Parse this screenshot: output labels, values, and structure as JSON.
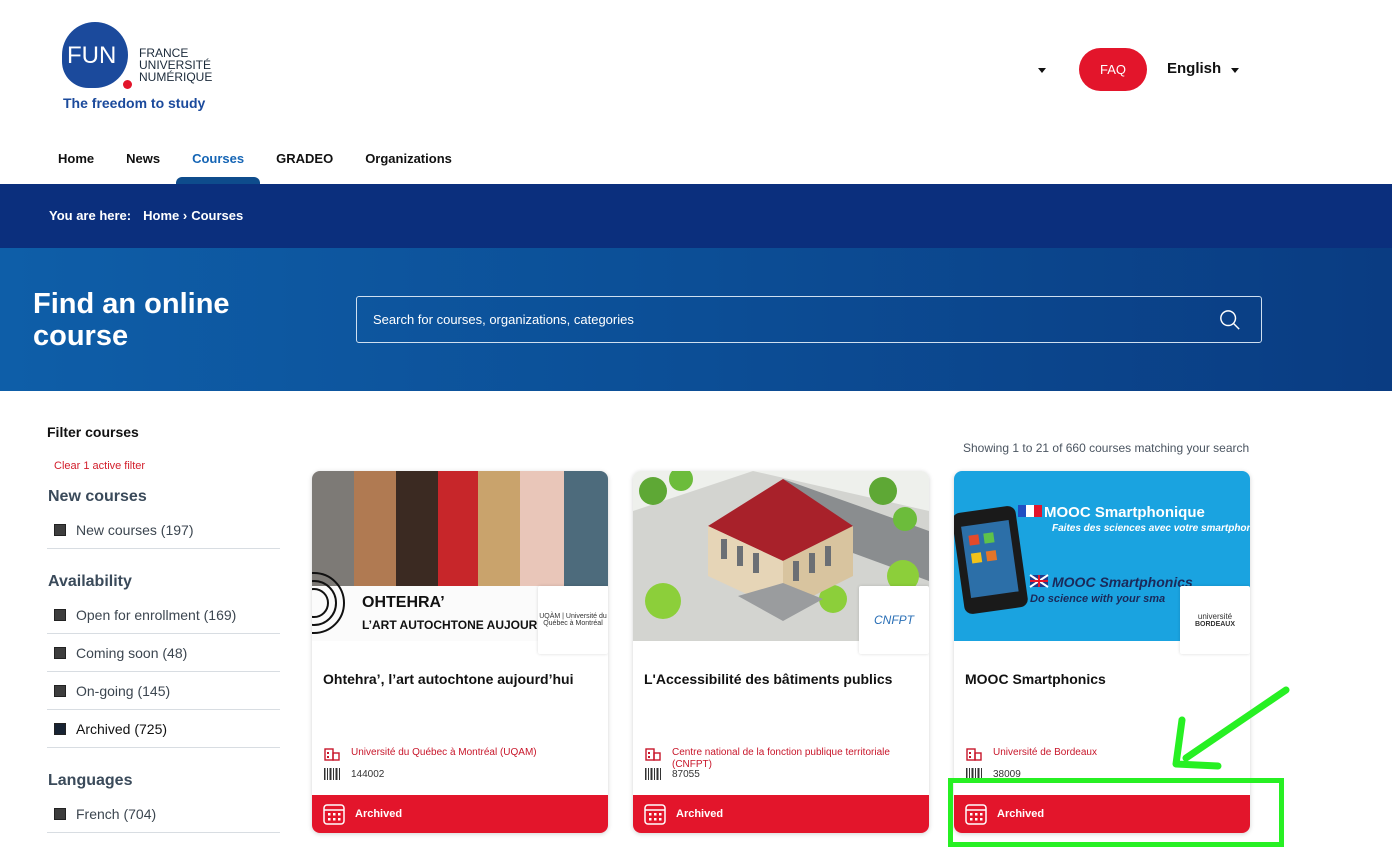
{
  "header": {
    "logo": {
      "mark": "FUN",
      "line1": "FRANCE",
      "line2": "UNIVERSITÉ",
      "line3": "NUMÉRIQUE",
      "tagline": "The freedom to study"
    },
    "faq_label": "FAQ",
    "language_label": "English"
  },
  "nav": {
    "items": [
      {
        "label": "Home",
        "active": false
      },
      {
        "label": "News",
        "active": false
      },
      {
        "label": "Courses",
        "active": true
      },
      {
        "label": "GRADEO",
        "active": false
      },
      {
        "label": "Organizations",
        "active": false
      }
    ]
  },
  "breadcrumb": {
    "prefix": "You are here:",
    "home": "Home ›",
    "current": "Courses"
  },
  "hero": {
    "title": "Find an online course",
    "search_placeholder": "Search for courses, organizations, categories"
  },
  "filters": {
    "title": "Filter courses",
    "clear_label": "Clear 1 active filter",
    "groups": [
      {
        "label": "New courses",
        "items": [
          {
            "label": "New courses (197)",
            "checked": false
          }
        ]
      },
      {
        "label": "Availability",
        "items": [
          {
            "label": "Open for enrollment (169)",
            "checked": false
          },
          {
            "label": "Coming soon (48)",
            "checked": false
          },
          {
            "label": "On-going (145)",
            "checked": false
          },
          {
            "label": "Archived (725)",
            "checked": true
          }
        ]
      },
      {
        "label": "Languages",
        "items": [
          {
            "label": "French (704)",
            "checked": false
          }
        ]
      }
    ]
  },
  "results": {
    "showing": "Showing 1 to 21 of 660 courses matching your search"
  },
  "cards": [
    {
      "title": "Ohtehra’, l’art autochtone aujourd’hui",
      "image_text_1": "OHTEHRA’",
      "image_text_2": "L’ART AUTOCHTONE AUJOURD’HUI",
      "org_logo_text": "UQÀM | Université du Québec à Montréal",
      "org": "Université du Québec à Montréal (UQAM)",
      "code": "144002",
      "status": "Archived"
    },
    {
      "title": "L'Accessibilité des bâtiments publics",
      "org_logo_text": "CNFPT",
      "org": "Centre national de la fonction publique territoriale (CNFPT)",
      "code": "87055",
      "status": "Archived"
    },
    {
      "title": "MOOC Smartphonics",
      "image_text_1": "MOOC Smartphonique",
      "image_text_2": "Faites des sciences avec votre smartphone !",
      "image_text_3": "MOOC Smartphonics",
      "image_text_4": "Do science with your sma",
      "org_logo_text_1": "université",
      "org_logo_text_2": "BORDEAUX",
      "org": "Université de Bordeaux",
      "code": "38009",
      "status": "Archived"
    }
  ],
  "colors": {
    "brand_red": "#e3152b",
    "brand_blue": "#0b2f7d",
    "nav_active": "#1565b5",
    "annotation_green": "#27f023"
  }
}
